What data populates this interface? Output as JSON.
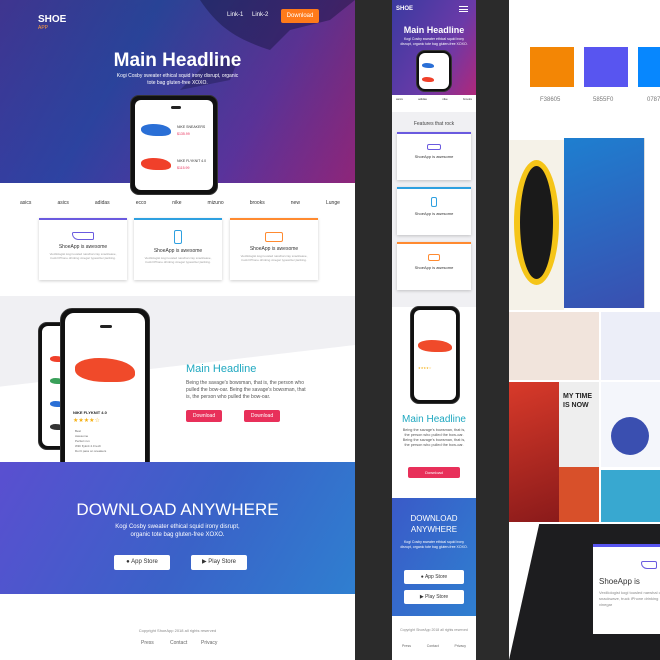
{
  "desktop": {
    "logo": "SHOE",
    "logo_sub": "APP",
    "nav": [
      "Link-1",
      "Link-2"
    ],
    "download_btn": "Download",
    "headline": "Main Headline",
    "subtext": "Kogi Cosby sweater ethical squid irony disrupt, organic tote bag gluten-free XOXO.",
    "phone_items": [
      {
        "name": "NIKE SNEAKERS",
        "price": "$135.99"
      },
      {
        "name": "NIKE FLYKNIT 4.0",
        "price": "$115.99"
      }
    ],
    "brands": [
      "asics",
      "asics",
      "adidas",
      "ecco",
      "nike",
      "mizuno",
      "brooks",
      "new",
      "Lunge"
    ],
    "features": [
      {
        "title": "ShoeApp is awesome",
        "desc": "Vexillologist kogi tousled narwhal cray snackwave, truck hPhone drinking vinegar typewriter jianbing.",
        "color": "#6a5adf"
      },
      {
        "title": "ShoeApp is awesome",
        "desc": "Vexillologist kogi tousled narwhal cray snackwave, truck hPhone drinking vinegar typewriter jianbing.",
        "color": "#2ea0e0"
      },
      {
        "title": "ShoeApp is awesome",
        "desc": "Vexillologist kogi tousled narwhal cray snackwave, truck hPhone drinking vinegar typewriter jianbing.",
        "color": "#ff8a30"
      }
    ],
    "product": {
      "name": "NIKE FLYKNIT 4.0",
      "features": [
        "Best",
        "Awesome",
        "Perfect run",
        "With flyknit 4.0 tech",
        "Don't pass on sneakers"
      ],
      "price": "$115.99"
    },
    "headline2": "Main Headline",
    "text2": "Being the savage's bowsman, that is, the person who pulled the bow-oar. Being the savage's bowsman, that is, the person who pulled the bow-oar.",
    "btn_a": "Download",
    "btn_b": "Download",
    "download_title": "DOWNLOAD ANYWHERE",
    "download_text": "Kogi Cosby sweater ethical squid irony disrupt, organic tote bag gluten-free XOXO.",
    "appstore": "App Store",
    "playstore": "Play Store",
    "copyright": "Copyright ShoeApp 2018 all rights reserved",
    "footer_links": [
      "Press",
      "Contact",
      "Privacy"
    ]
  },
  "mobile": {
    "logo": "SHOE",
    "headline": "Main Headline",
    "subtext": "Kogi Cosby sweater ethical squid irony disrupt, organic tote bag gluten-free XOXO.",
    "features_title": "Features that rock",
    "feature_title": "ShoeApp is awesome",
    "headline2": "Main Headline",
    "text2": "Being the savage's bowsman, that is, the person who pulled the bow-oar. Being the savage's bowsman, that is, the person who pulled the bow-oar.",
    "download": "Download",
    "dl_title": "DOWNLOAD ANYWHERE",
    "dl_text": "Kogi Cosby sweater ethical squid irony disrupt, organic tote bag gluten-free XOXO.",
    "appstore": "App Store",
    "playstore": "Play Store",
    "copyright": "Copyright ShoeApp 2018 all rights reserved",
    "links": [
      "Press",
      "Contact",
      "Privacy"
    ]
  },
  "palette": [
    {
      "hex": "#F38605",
      "label": "F38605"
    },
    {
      "hex": "#5855F0",
      "label": "5855F0"
    },
    {
      "hex": "#0787FE",
      "label": "0787"
    }
  ],
  "moodboard": {
    "poster_text": "MY TIME IS NOW",
    "card_title": "ShoeApp is",
    "card_text": "Vexillologist kogi tousled narwhal cray snackwave, truck iPhone drinking vinegar"
  }
}
